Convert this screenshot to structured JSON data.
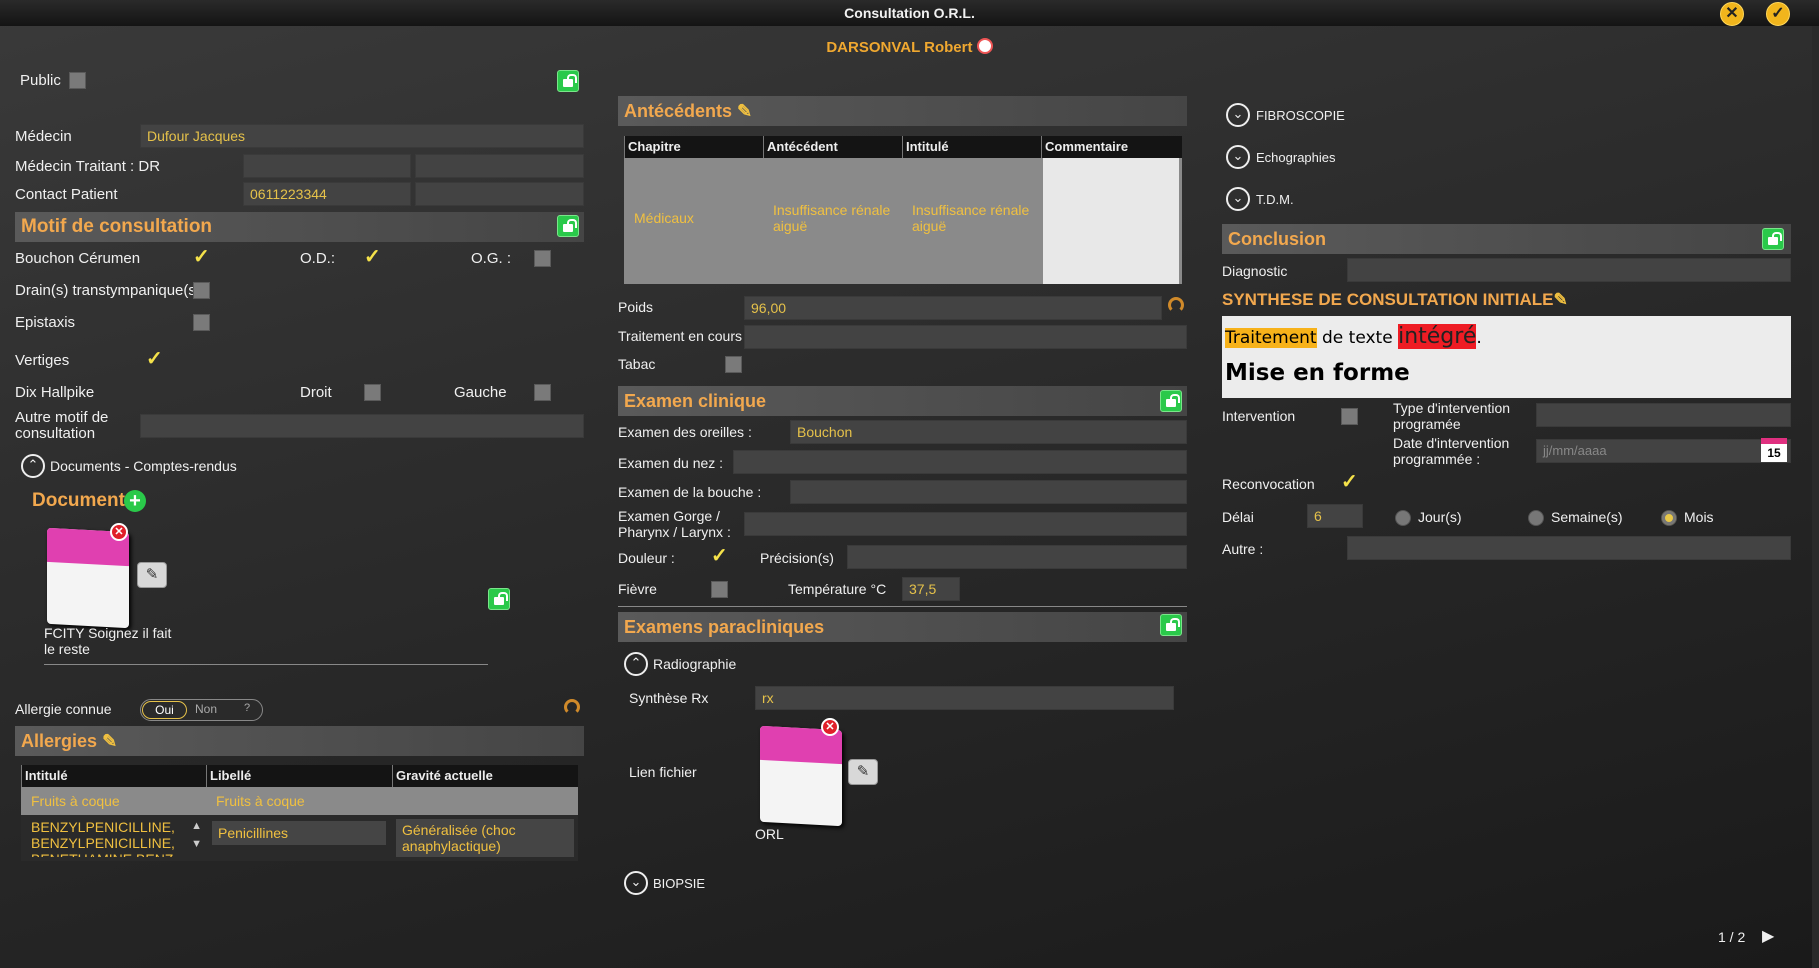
{
  "window": {
    "title": "Consultation O.R.L.",
    "patient": "DARSONVAL Robert",
    "page": "1 / 2"
  },
  "left": {
    "public_label": "Public",
    "medecin_label": "Médecin",
    "medecin_value": "Dufour Jacques",
    "traitant_label": "Médecin Traitant : DR",
    "contact_label": "Contact Patient",
    "contact_value": "0611223344",
    "motif_title": "Motif de consultation",
    "bouchon": "Bouchon Cérumen",
    "od": "O.D.:",
    "og": "O.G. :",
    "drain": "Drain(s) transtympanique(s):",
    "epistaxis": "Epistaxis",
    "vertiges": "Vertiges",
    "dix": "Dix Hallpike",
    "droit": "Droit",
    "gauche": "Gauche",
    "autre_motif": "Autre motif de consultation",
    "documents_toggle": "Documents - Comptes-rendus",
    "document_title": "Document",
    "doc_name": "FCITY Soignez il  fait le reste",
    "allergie_label": "Allergie connue",
    "oui": "Oui",
    "non": "Non",
    "q": "?",
    "allergies_title": "Allergies",
    "allergies_headers": [
      "Intitulé",
      "Libellé",
      "Gravité actuelle"
    ],
    "allergies_rows": [
      [
        "Fruits à coque",
        "Fruits à coque",
        ""
      ],
      [
        "BENZYLPENICILLINE, BENZYLPENICILLINE, BENETHAMINE BENZ",
        "Penicillines",
        "Généralisée (choc anaphylactique)"
      ]
    ]
  },
  "mid": {
    "antecedents_title": "Antécédents",
    "ant_headers": [
      "Chapitre",
      "Antécédent",
      "Intitulé",
      "Commentaire"
    ],
    "ant_row": [
      "Médicaux",
      "Insuffisance rénale aiguë",
      "Insuffisance rénale aiguë",
      ""
    ],
    "poids_label": "Poids",
    "poids_value": "96,00",
    "traitement_label": "Traitement en cours",
    "tabac_label": "Tabac",
    "examen_title": "Examen clinique",
    "oreilles_label": "Examen des oreilles :",
    "oreilles_value": "Bouchon",
    "nez_label": "Examen du nez :",
    "bouche_label": "Examen de la bouche :",
    "gorge_label": "Examen Gorge / Pharynx / Larynx :",
    "douleur_label": "Douleur :",
    "precision_label": "Précision(s)",
    "fievre_label": "Fièvre",
    "temp_label": "Température °C",
    "temp_value": "37,5",
    "paraclin_title": "Examens paracliniques",
    "radio_toggle": "Radiographie",
    "synthese_rx_label": "Synthèse Rx",
    "synthese_rx_value": "rx",
    "lien_label": "Lien fichier",
    "orl_label": "ORL",
    "biopsie_toggle": "BIOPSIE"
  },
  "right": {
    "fibro": "FIBROSCOPIE",
    "echo": "Echographies",
    "tdm": "T.D.M.",
    "conclusion_title": "Conclusion",
    "diagnostic_label": "Diagnostic",
    "synthese_title": "SYNTHESE DE CONSULTATION INITIALE",
    "rt_w1": "Traitement",
    "rt_w2": " de texte ",
    "rt_w3": "intégré",
    "rt_w4": ".",
    "rt_line2": "Mise en forme",
    "intervention_label": "Intervention",
    "type_label": "Type d'intervention programée",
    "date_label": "Date d'intervention programmée :",
    "date_placeholder": "jj/mm/aaaa",
    "cal_day": "15",
    "reconvocation_label": "Reconvocation",
    "delai_label": "Délai",
    "delai_value": "6",
    "jours": "Jour(s)",
    "semaine": "Semaine(s)",
    "mois": "Mois",
    "autre_label": "Autre :"
  },
  "colors": {
    "accent": "#f2a84e",
    "value": "#e6c24a",
    "section_bg": "#555555"
  }
}
